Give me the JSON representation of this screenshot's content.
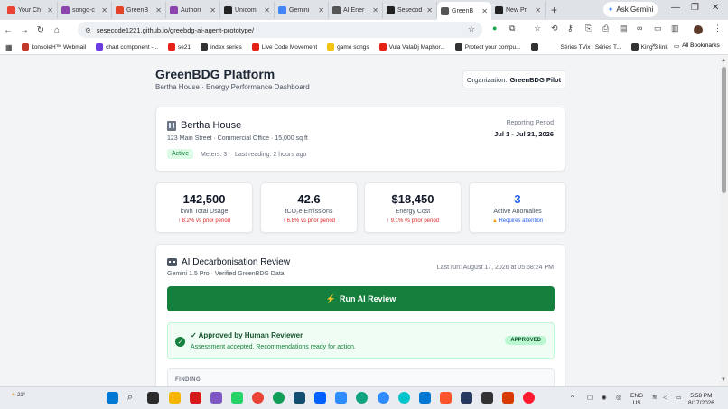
{
  "browser": {
    "tabs": [
      {
        "label": "Your Ch",
        "color": "#ea4335"
      },
      {
        "label": "songo-c",
        "color": "#8e44ad"
      },
      {
        "label": "GreenB",
        "color": "#e24329"
      },
      {
        "label": "Authori",
        "color": "#8e44ad"
      },
      {
        "label": "Unicom",
        "color": "#222222"
      },
      {
        "label": "Gemini",
        "color": "#4285f4"
      },
      {
        "label": "AI Ener",
        "color": "#555555"
      },
      {
        "label": "Sesecod",
        "color": "#222222"
      },
      {
        "label": "GreenB",
        "color": "#555555",
        "active": true
      },
      {
        "label": "New Pr",
        "color": "#222222"
      }
    ],
    "ask_gemini": "Ask Gemini",
    "url": "sesecode1221.github.io/greebdg-ai-agent-prototype/",
    "bookmarks": [
      {
        "label": "konsoleH™ Webmail",
        "color": "#c0392b"
      },
      {
        "label": "chart component -...",
        "color": "#6c3ce0"
      },
      {
        "label": "se21",
        "color": "#e62117"
      },
      {
        "label": "index series",
        "color": "#333333"
      },
      {
        "label": "Live Code Movement",
        "color": "#e62117"
      },
      {
        "label": "game songs",
        "color": "#f1c40f"
      },
      {
        "label": "Vula ValaDj Maphor...",
        "color": "#e62117"
      },
      {
        "label": "Protect your compu...",
        "color": "#333333"
      },
      {
        "label": "",
        "color": "#333333"
      },
      {
        "label": "Séries TVix | Séries T...",
        "color": "#ffffff"
      },
      {
        "label": "King 3 link",
        "color": "#333333"
      }
    ],
    "all_bookmarks": "All Bookmarks"
  },
  "header": {
    "title": "GreenBDG Platform",
    "subtitle": "Bertha House · Energy Performance Dashboard",
    "org_label": "Organization:",
    "org_value": "GreenBDG Pilot"
  },
  "property": {
    "name": "Bertha House",
    "address": "123 Main Street · Commercial Office · 15,000 sq ft",
    "status": "Active",
    "meters": "Meters: 3",
    "last_reading": "Last reading: 2 hours ago",
    "reporting_label": "Reporting Period",
    "reporting_value": "Jul 1 - Jul 31, 2026"
  },
  "kpis": [
    {
      "value": "142,500",
      "label": "kWh Total Usage",
      "delta": "↑ 8.2% vs prior period"
    },
    {
      "value": "42.6",
      "label": "tCO₂e Emissions",
      "delta": "↑ 6.8% vs prior period"
    },
    {
      "value": "$18,450",
      "label": "Energy Cost",
      "delta": "↑ 9.1% vs prior period"
    },
    {
      "value": "3",
      "label": "Active Anomalies",
      "alert": "Requires attention"
    }
  ],
  "colors": {
    "accent_green": "#15803d",
    "anomaly_blue": "#2563eb",
    "delta_red": "#dc2626"
  },
  "ai_review": {
    "title": "AI Decarbonisation Review",
    "subtitle": "Gemini 1.5 Pro · Verified GreenBDG Data",
    "last_run": "Last run: August 17, 2026 at 05:58:24 PM",
    "run_button": "Run AI Review",
    "approval_title": "✓ Approved by Human Reviewer",
    "approval_sub": "Assessment accepted. Recommendations ready for action.",
    "approved_badge": "APPROVED",
    "finding_label": "FINDING"
  },
  "taskbar": {
    "weather": "21°",
    "lang1": "ENG",
    "lang2": "US",
    "time": "5:58 PM",
    "date": "8/17/2026"
  }
}
